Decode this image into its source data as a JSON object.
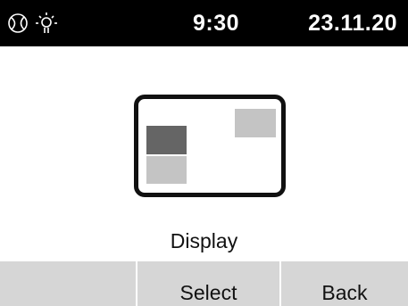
{
  "status_bar": {
    "icons": [
      "sun-moon-icon",
      "brightness-icon"
    ],
    "time": "9:30",
    "date": "23.11.20"
  },
  "main": {
    "illustration": "display-layout-icon",
    "title": "Display"
  },
  "softkeys": {
    "left_label": "",
    "middle_label": "Select",
    "right_label": "Back"
  },
  "colors": {
    "status_bar_bg": "#000000",
    "softkey_bg": "#d6d6d6",
    "dark_window": "#656565",
    "light_window": "#c4c4c4"
  }
}
